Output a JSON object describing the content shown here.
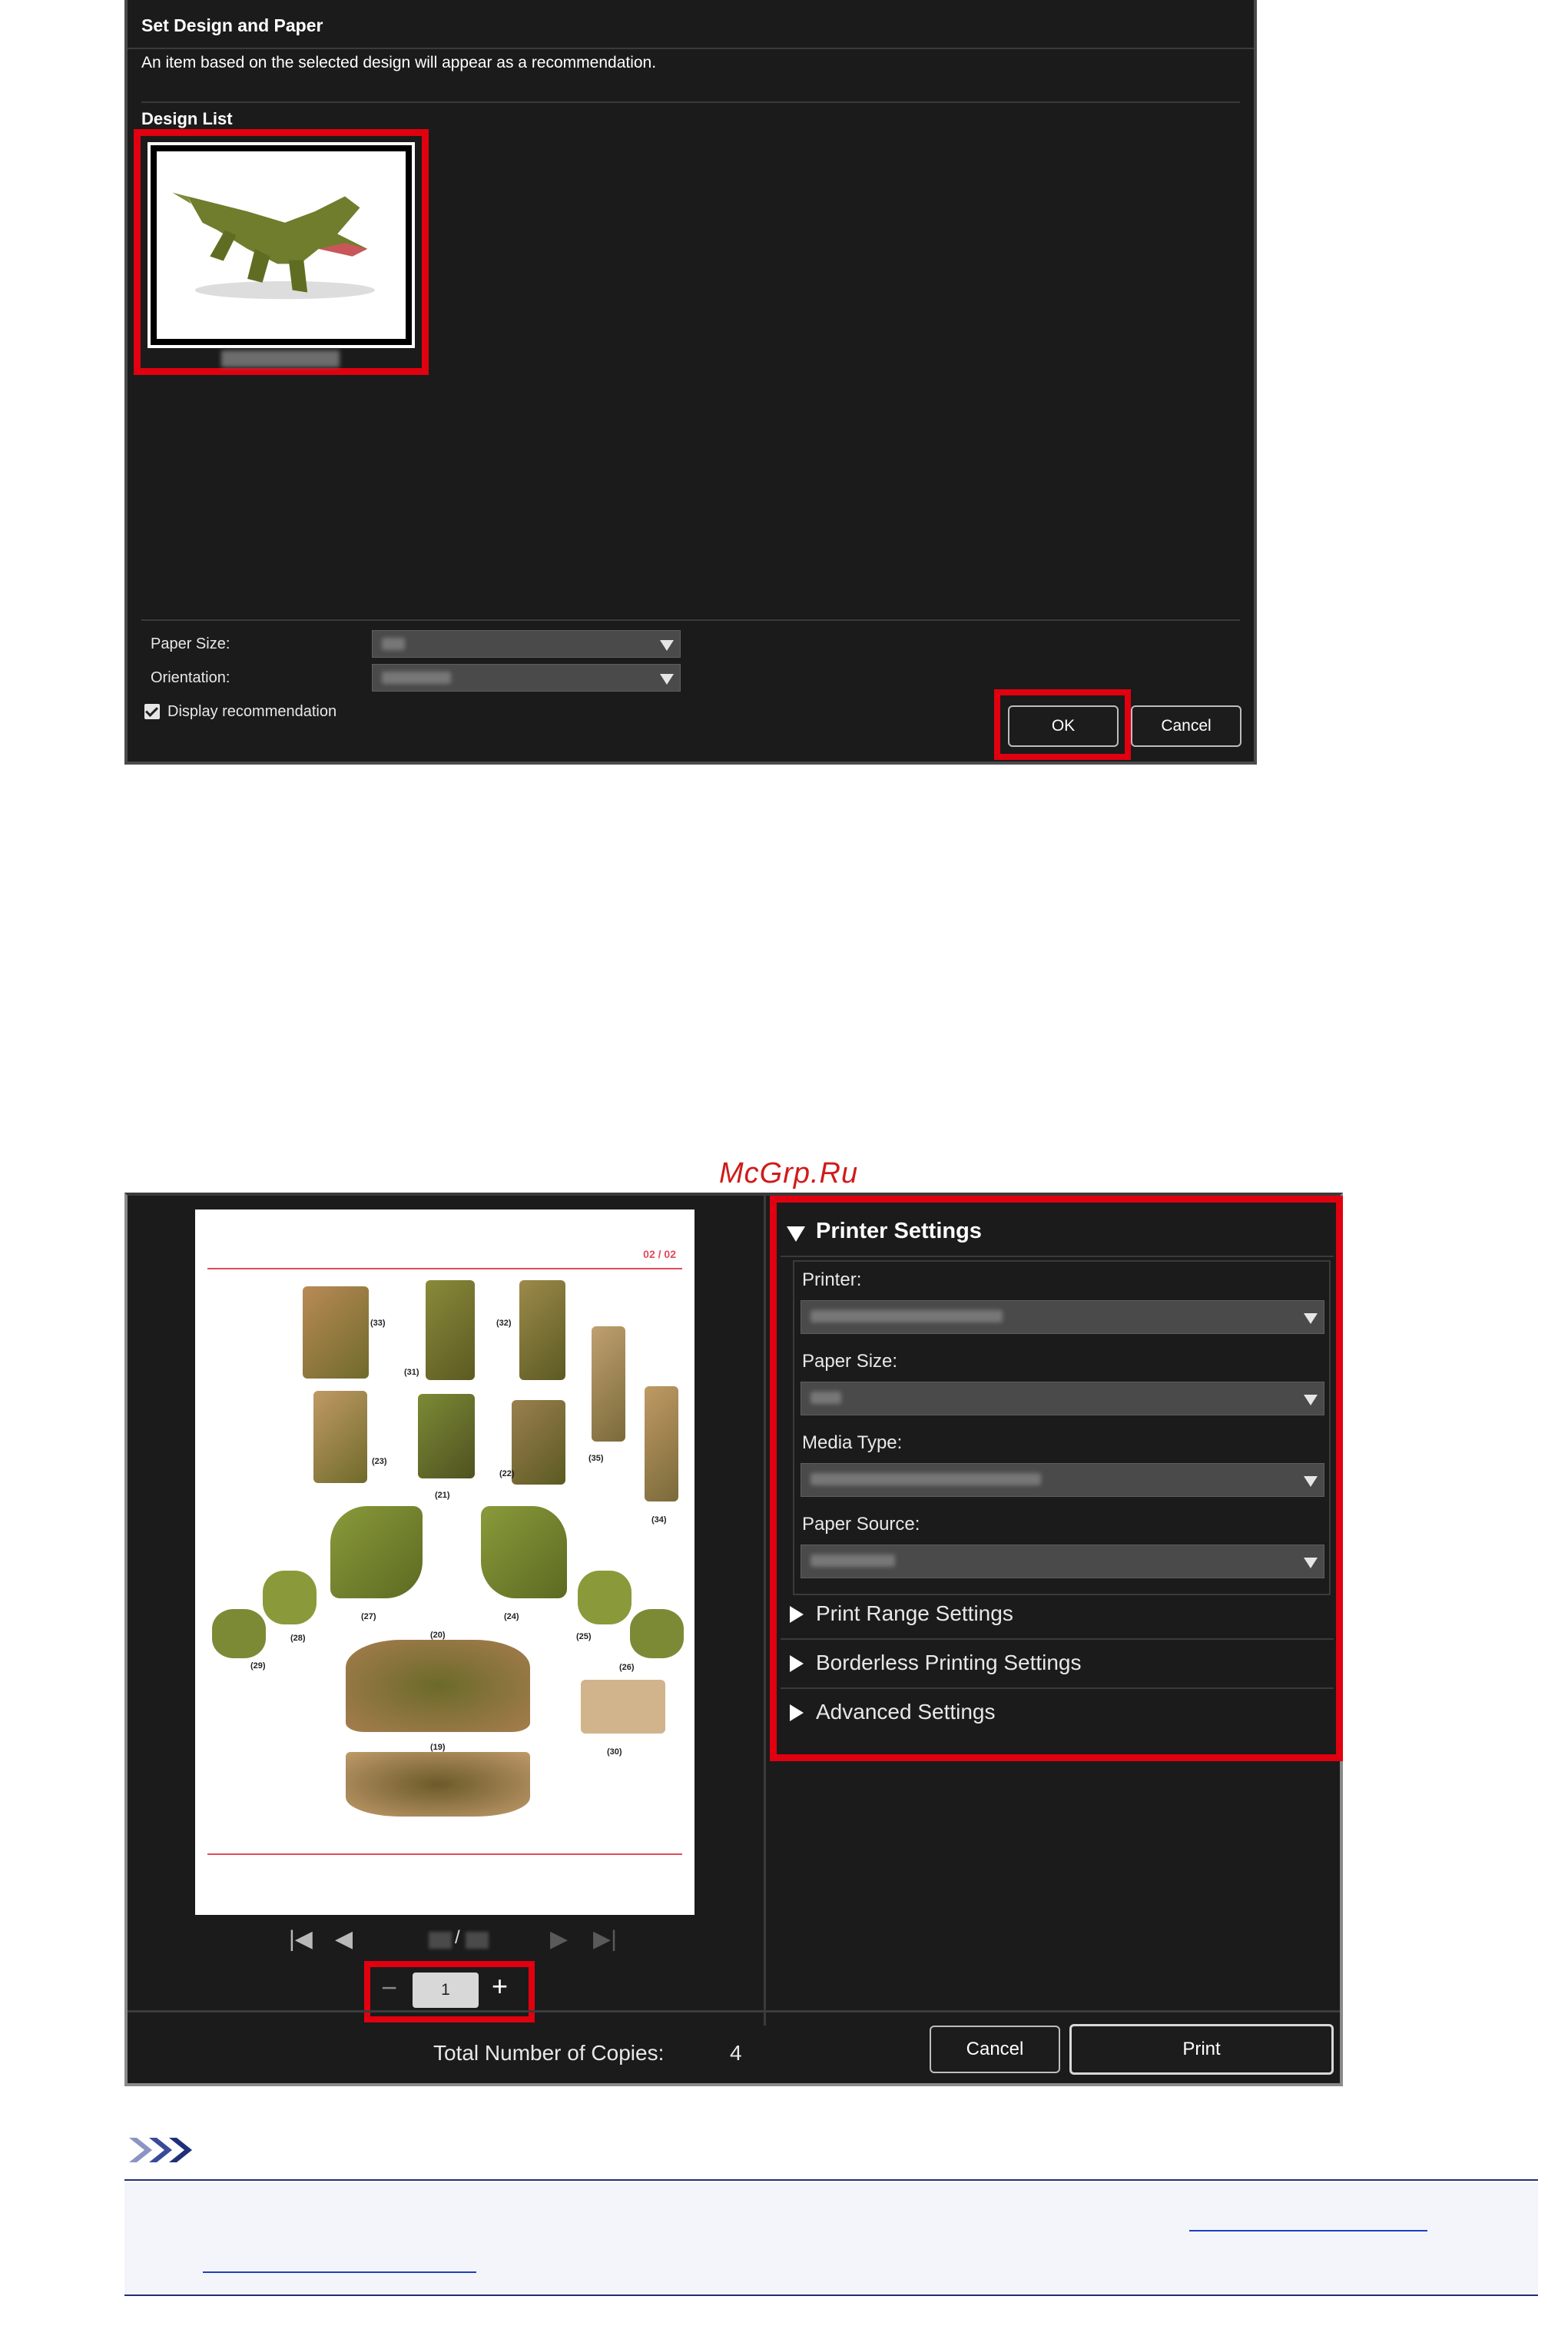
{
  "dialog1": {
    "title": "Set Design and Paper",
    "description": "An item based on the selected design will appear as a recommendation.",
    "design_list_label": "Design List",
    "paper_size_label": "Paper Size:",
    "orientation_label": "Orientation:",
    "display_recommendation_label": "Display recommendation",
    "display_recommendation_checked": true,
    "ok_label": "OK",
    "cancel_label": "Cancel"
  },
  "watermark": "McGrp.Ru",
  "dialog2": {
    "page_indicator": "02 / 02",
    "page_nav_separator": "/",
    "copies_value": "1",
    "minus_label": "−",
    "plus_label": "+",
    "printer_settings_label": "Printer Settings",
    "printer_label": "Printer:",
    "paper_size_label": "Paper Size:",
    "media_type_label": "Media Type:",
    "paper_source_label": "Paper Source:",
    "print_range_label": "Print Range Settings",
    "borderless_label": "Borderless Printing Settings",
    "advanced_label": "Advanced Settings",
    "total_copies_label": "Total Number of Copies:",
    "total_copies_value": "4",
    "cancel_label": "Cancel",
    "print_label": "Print",
    "piece_labels": [
      "(33)",
      "(31)",
      "(32)",
      "(35)",
      "(23)",
      "(21)",
      "(22)",
      "(34)",
      "(28)",
      "(27)",
      "(20)",
      "(24)",
      "(25)",
      "(29)",
      "(26)",
      "(19)",
      "(30)"
    ]
  },
  "colors": {
    "dialog_bg": "#1b1b1b",
    "highlight": "#e0000f",
    "watermark": "#d01b1b",
    "note_line": "#1f2f7a"
  }
}
